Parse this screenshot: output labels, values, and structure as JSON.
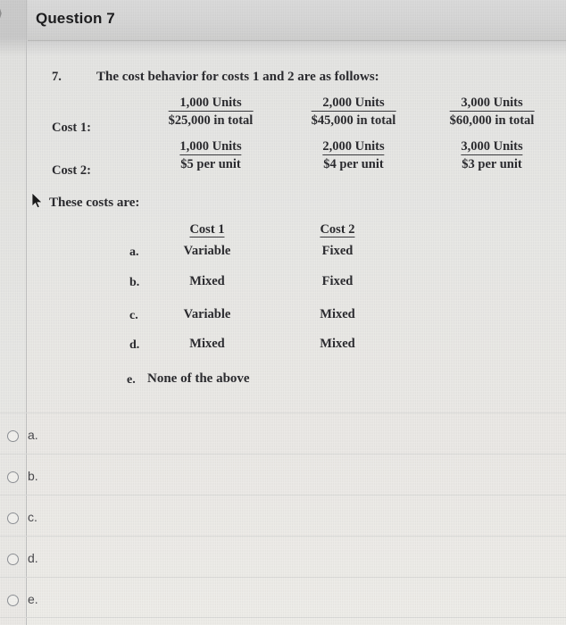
{
  "header": {
    "title": "Question 7",
    "collapse_icon": "chevron-right-icon"
  },
  "question": {
    "number": "7.",
    "stem": "The cost behavior for costs 1 and 2 are as follows:",
    "cost_rows": [
      {
        "label": "Cost 1:",
        "cells": [
          {
            "units": "1,000 Units",
            "amount": "$25,000 in total"
          },
          {
            "units": "2,000 Units",
            "amount": "$45,000 in total"
          },
          {
            "units": "3,000 Units",
            "amount": "$60,000 in total"
          }
        ]
      },
      {
        "label": "Cost 2:",
        "cells": [
          {
            "units": "1,000 Units",
            "amount": "$5 per unit"
          },
          {
            "units": "2,000 Units",
            "amount": "$4 per unit"
          },
          {
            "units": "3,000 Units",
            "amount": "$3 per unit"
          }
        ]
      }
    ],
    "prompt": "These costs are:",
    "cursor_icon": "mouse-pointer-icon",
    "options_table": {
      "headers": [
        "Cost 1",
        "Cost 2"
      ],
      "rows": [
        {
          "letter": "a.",
          "cost1": "Variable",
          "cost2": "Fixed"
        },
        {
          "letter": "b.",
          "cost1": "Mixed",
          "cost2": "Fixed"
        },
        {
          "letter": "c.",
          "cost1": "Variable",
          "cost2": "Mixed"
        },
        {
          "letter": "d.",
          "cost1": "Mixed",
          "cost2": "Mixed"
        }
      ],
      "none_option": {
        "letter": "e.",
        "text": "None of the above"
      }
    }
  },
  "answers": {
    "options": [
      {
        "label": "a.",
        "selected": false
      },
      {
        "label": "b.",
        "selected": false
      },
      {
        "label": "c.",
        "selected": false
      },
      {
        "label": "d.",
        "selected": false
      },
      {
        "label": "e.",
        "selected": false
      }
    ]
  },
  "colors": {
    "header_bg": "#d7d7d7",
    "page_bg": "#e9e9e6",
    "text": "#2b2b2f",
    "label_text": "#4a4a4e",
    "divider": "#dcdcda",
    "radio_border": "#8e9196"
  }
}
